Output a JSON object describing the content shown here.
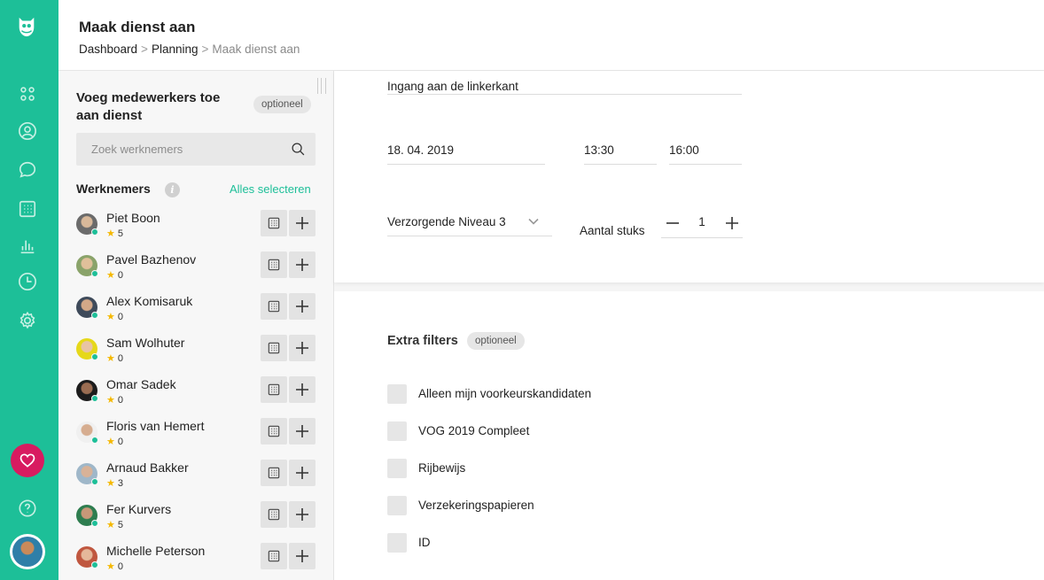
{
  "header": {
    "title": "Maak dienst aan",
    "breadcrumb": [
      "Dashboard",
      "Planning",
      "Maak dienst aan"
    ]
  },
  "panel": {
    "title": "Voeg medewerkers toe aan dienst",
    "optional_badge": "optioneel",
    "search_placeholder": "Zoek werknemers",
    "employees_heading": "Werknemers",
    "select_all_label": "Alles selecteren",
    "employees": [
      {
        "name": "Piet Boon",
        "rating": "5"
      },
      {
        "name": "Pavel Bazhenov",
        "rating": "0"
      },
      {
        "name": "Alex Komisaruk",
        "rating": "0"
      },
      {
        "name": "Sam Wolhuter",
        "rating": "0"
      },
      {
        "name": "Omar Sadek",
        "rating": "0"
      },
      {
        "name": "Floris van Hemert",
        "rating": "0"
      },
      {
        "name": "Arnaud Bakker",
        "rating": "3"
      },
      {
        "name": "Fer Kurvers",
        "rating": "5"
      },
      {
        "name": "Michelle Peterson",
        "rating": "0"
      }
    ]
  },
  "shift": {
    "entrance": "Ingang aan de linkerkant",
    "date": "18. 04. 2019",
    "start_time": "13:30",
    "end_time": "16:00",
    "level": "Verzorgende Niveau 3",
    "quantity_label": "Aantal stuks",
    "quantity": "1"
  },
  "filters": {
    "title": "Extra filters",
    "optional_badge": "optioneel",
    "options": [
      "Alleen mijn voorkeurskandidaten",
      "VOG 2019 Compleet",
      "Rijbewijs",
      "Verzekeringspapieren",
      "ID"
    ]
  },
  "colors": {
    "accent": "#1dbf98",
    "heart": "#d81b60",
    "star": "#f5b800"
  }
}
